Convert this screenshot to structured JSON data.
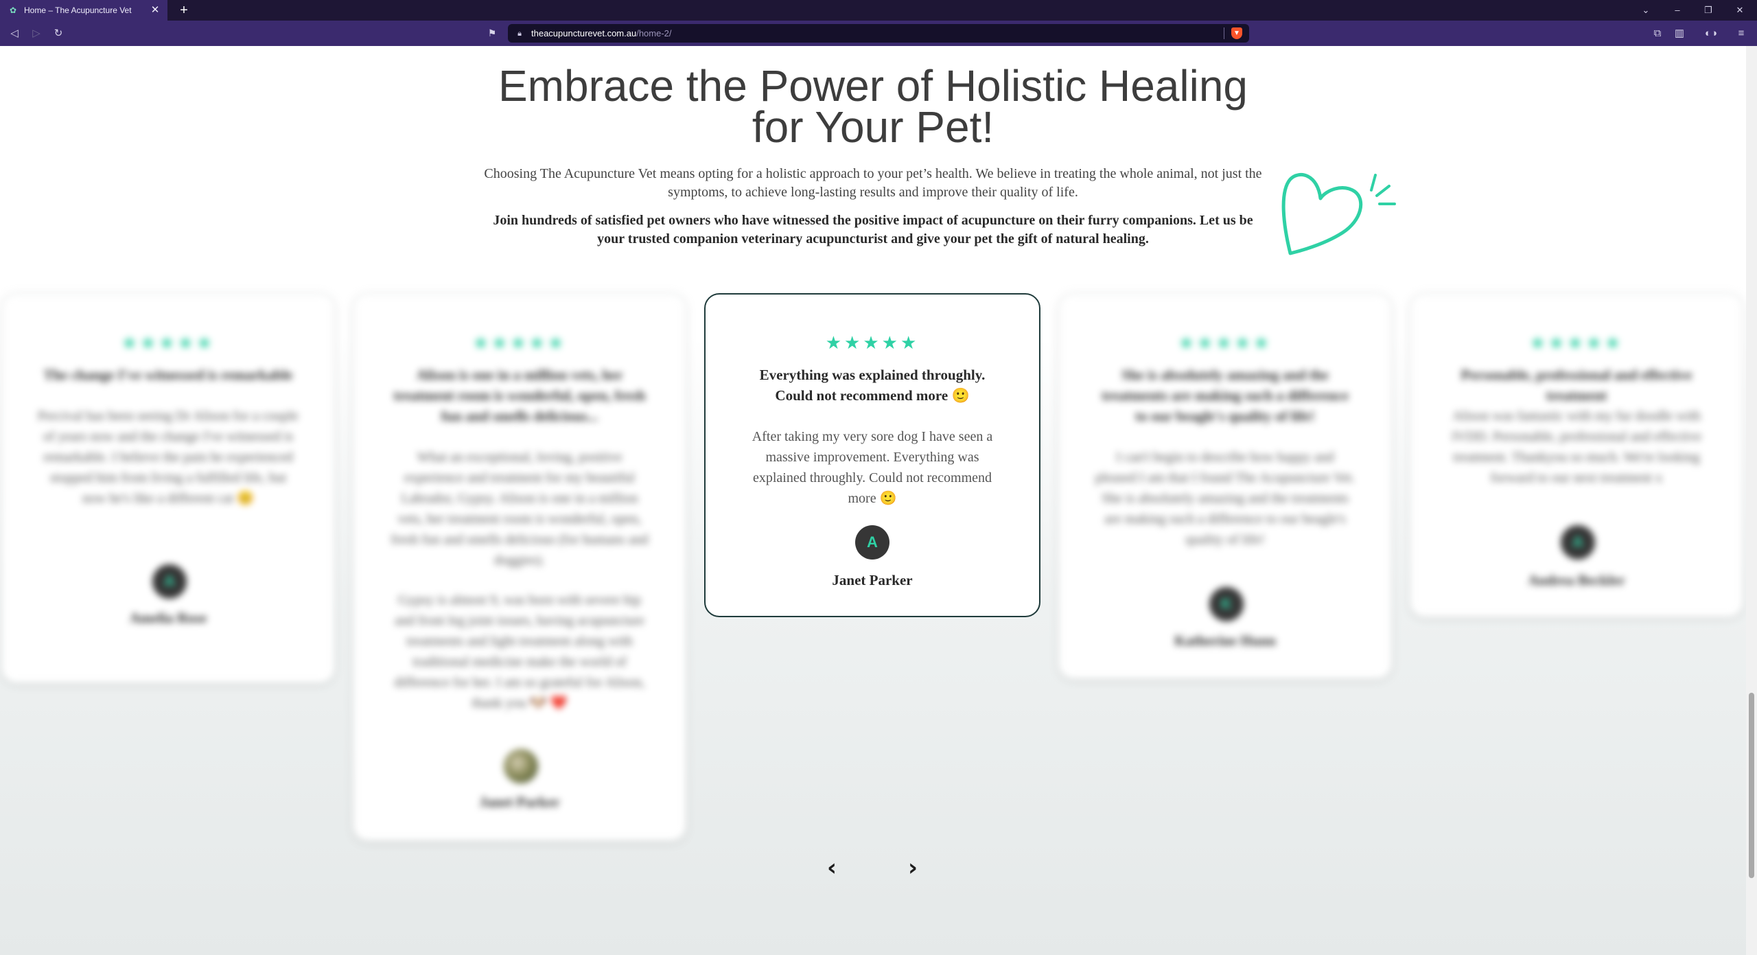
{
  "browser": {
    "tab_title": "Home – The Acupuncture Vet",
    "tab_close": "✕",
    "new_tab": "+",
    "url_host": "theacupuncturevet.com.au",
    "url_path": "/home-2/",
    "icons": [
      "back-icon",
      "forward-icon",
      "reload-icon",
      "bookmark-icon",
      "lock-icon",
      "brave-shield-icon",
      "extensions-icon",
      "sidebar-icon",
      "vpn-icon",
      "menu-icon",
      "minimize-icon",
      "maximize-icon",
      "close-icon"
    ]
  },
  "hero": {
    "headline_line1": "Embrace the Power of Holistic Healing",
    "headline_line2": "for Your Pet!",
    "intro": "Choosing The Acupuncture Vet means opting for a holistic approach to your pet’s health. We believe in treating the whole animal, not just the symptoms, to achieve long-lasting results and improve their quality of life.",
    "intro_bold": "Join hundreds of satisfied pet owners who have witnessed the positive impact of acupuncture on their furry companions. Let us be your trusted companion veterinary acupuncturist and give your pet the gift of natural healing.",
    "accent_color": "#2fd1a5"
  },
  "testimonials": [
    {
      "stars": "★★★★★",
      "rating": 5,
      "title": "The change I've witnessed is remarkable",
      "body": "Percival has been seeing Dr Alison for a couple of years now and the change I've witnessed is remarkable. I believe the pain he experienced stopped him from living a fulfilled life, but now he's like a different cat 😊",
      "avatar": "A",
      "author": "Amelia Rose"
    },
    {
      "stars": "★★★★★",
      "rating": 5,
      "title": "Alison is one in a million vets, her treatment room is wonderful, open, fresh fun and smells delicious...",
      "body": "What an exceptional, loving, positive experience and treatment for my beautiful Labrador, Gypsy. Alison is one in a million vets, her treatment room is wonderful, open, fresh fun and smells delicious (for humans and doggies).",
      "body2": "Gypsy is almost 9, was born with severe hip and front leg joint issues, having acupuncture treatments and light treatment along with traditional medicine make the world of difference for her. I am so grateful for Alison, thank you 🐶 ❤️",
      "avatar": "",
      "author": "Janet Parker"
    },
    {
      "stars": "★★★★★",
      "rating": 5,
      "title": "Everything was explained throughly. Could not recommend more 🙂",
      "body": "After taking my very sore dog I have seen a massive improvement. Everything was explained throughly. Could not recommend more 🙂",
      "avatar": "A",
      "author": "Janet Parker"
    },
    {
      "stars": "★★★★★",
      "rating": 5,
      "title": "She is absolutely amazing and the treatments are making such a difference to our beagle's quality of life!",
      "body": "I can't begin to describe how happy and pleased I am that I found The Acupuncture Vet. She is absolutely amazing and the treatments are making such a difference to our beagle's quality of life!",
      "avatar": "K",
      "author": "Katherine Hunn"
    },
    {
      "stars": "★★★★★",
      "rating": 5,
      "title": "Personable, professional and effective treatment",
      "body": "Alison was fantastic with my fur doodle with IVDD. Personable, professional and effective treatment. Thankyou so much. We're looking forward to our next treatment x",
      "avatar": "A",
      "author": "Andrea Beckler"
    }
  ],
  "slider": {
    "prev": "‹",
    "next": "›"
  }
}
